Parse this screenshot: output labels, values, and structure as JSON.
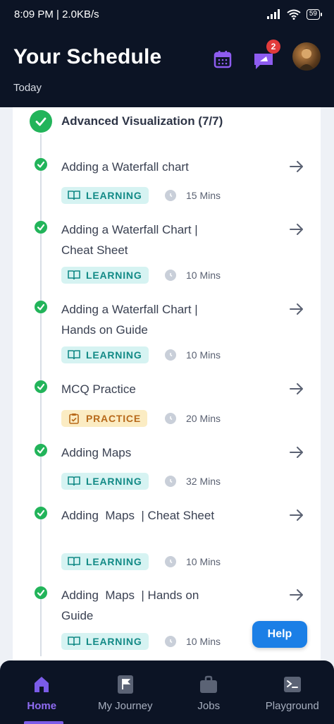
{
  "status_bar": {
    "time_speed": "8:09 PM | 2.0KB/s",
    "battery": "59"
  },
  "header": {
    "title": "Your Schedule",
    "subtitle": "Today",
    "notification_count": "2"
  },
  "module": {
    "title": "Advanced Visualization (7/7)"
  },
  "items": [
    {
      "title": "Adding a Waterfall chart",
      "tag": "LEARNING",
      "duration": "15 Mins"
    },
    {
      "title": "Adding a Waterfall Chart | Cheat Sheet",
      "tag": "LEARNING",
      "duration": "10 Mins"
    },
    {
      "title": "Adding a Waterfall Chart | Hands on Guide",
      "tag": "LEARNING",
      "duration": "10 Mins"
    },
    {
      "title": "MCQ Practice",
      "tag": "PRACTICE",
      "duration": "20 Mins"
    },
    {
      "title": "Adding Maps",
      "tag": "LEARNING",
      "duration": "32 Mins"
    },
    {
      "title": "Adding  Maps  | Cheat Sheet",
      "tag": "LEARNING",
      "duration": "10 Mins"
    },
    {
      "title": "Adding  Maps  | Hands on Guide",
      "tag": "LEARNING",
      "duration": "10 Mins"
    }
  ],
  "help_label": "Help",
  "nav": [
    {
      "label": "Home"
    },
    {
      "label": "My Journey"
    },
    {
      "label": "Jobs"
    },
    {
      "label": "Playground"
    }
  ]
}
